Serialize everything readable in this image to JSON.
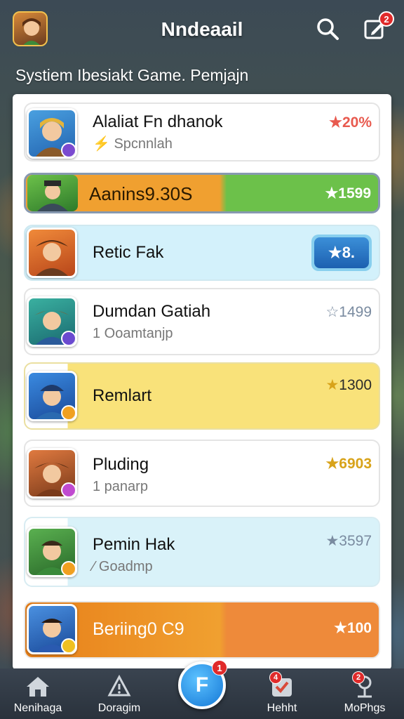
{
  "header": {
    "title": "Nndeaail",
    "subtitle": "Systiem Ibesiakt Game.  Pemjajn",
    "notification_count": "2"
  },
  "rows": [
    {
      "name": "Alaliat Fn dhanok",
      "sub": "Spcnnlah",
      "score": "20%",
      "accent": "#e85a4f"
    },
    {
      "name": "Aanins9.30S",
      "sub": "",
      "score": "1599",
      "accent": "#ffffff"
    },
    {
      "name": "Retic Fak",
      "sub": "",
      "score": "8.",
      "accent": "#ffffff"
    },
    {
      "name": "Dumdan Gatiah",
      "sub": "1 Ooamtanjp",
      "score": "1499",
      "accent": "#7a8ba0"
    },
    {
      "name": "Remlart",
      "sub": "",
      "score": "1300",
      "accent": "#d8a31a"
    },
    {
      "name": "Pluding",
      "sub": "1 panarp",
      "score": "6903",
      "accent": "#d8a31a"
    },
    {
      "name": "Pemin Hak",
      "sub": "Goadmp",
      "score": "3597",
      "accent": "#7a8ba0"
    },
    {
      "name": "Beriing0 C9",
      "sub": "",
      "score": "100",
      "accent": "#ffffff"
    }
  ],
  "nav": {
    "items": [
      {
        "label": "Nenihaga"
      },
      {
        "label": "Doragim"
      },
      {
        "label": "Hehht"
      },
      {
        "label": "MoPhgs"
      }
    ],
    "fab_label": "F",
    "fab_badge": "1",
    "badge_hehht": "4",
    "badge_mophgs": "2"
  },
  "colors": {
    "green_bar": "#6cc14a",
    "orange_bar": "#f0a030",
    "light_blue": "#d3f1fb",
    "yellow": "#f9e27a",
    "accent_blue": "#1477d6"
  }
}
